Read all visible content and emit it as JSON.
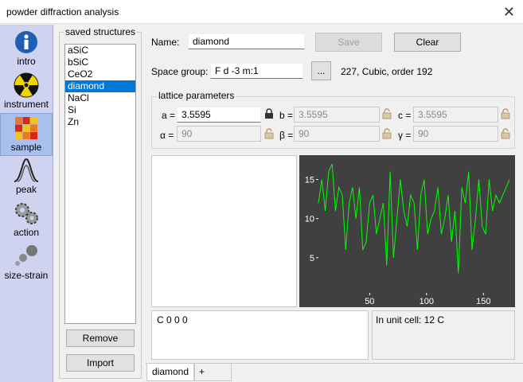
{
  "window": {
    "title": "powder diffraction analysis"
  },
  "sidebar": {
    "items": [
      {
        "label": "intro",
        "icon": "info-icon"
      },
      {
        "label": "instrument",
        "icon": "radiation-icon"
      },
      {
        "label": "sample",
        "icon": "sample-grid-icon"
      },
      {
        "label": "peak",
        "icon": "peak-icon"
      },
      {
        "label": "action",
        "icon": "gears-icon"
      },
      {
        "label": "size-strain",
        "icon": "spheres-icon"
      }
    ]
  },
  "saved": {
    "title": "saved structures",
    "items": [
      "aSiC",
      "bSiC",
      "CeO2",
      "diamond",
      "NaCl",
      "Si",
      "Zn"
    ],
    "selected": "diamond",
    "remove_label": "Remove",
    "import_label": "Import"
  },
  "form": {
    "name_label": "Name:",
    "name_value": "diamond",
    "save_label": "Save",
    "clear_label": "Clear",
    "space_group_label": "Space group:",
    "space_group_value": "F d -3 m:1",
    "browse_label": "...",
    "space_group_info": "227, Cubic, order 192"
  },
  "lattice": {
    "title": "lattice parameters",
    "a_label": "a =",
    "a_value": "3.5595",
    "b_label": "b =",
    "b_value": "3.5595",
    "c_label": "c =",
    "c_value": "3.5595",
    "alpha_label": "α =",
    "alpha_value": "90",
    "beta_label": "β =",
    "beta_value": "90",
    "gamma_label": "γ =",
    "gamma_value": "90"
  },
  "atoms": {
    "text": "C 0 0 0"
  },
  "unit_cell": {
    "text": "In unit cell: 12 C"
  },
  "tabs": {
    "active": "diamond",
    "add": "+"
  },
  "colors": {
    "plot_bg": "#404040",
    "plot_line": "#00ff00",
    "selection": "#0078d7",
    "sidebar": "#cfd3f0"
  },
  "chart_data": {
    "type": "line",
    "title": "",
    "xlabel": "",
    "ylabel": "",
    "xlim": [
      5,
      175
    ],
    "ylim": [
      0.5,
      17.5
    ],
    "xticks": [
      50,
      100,
      150
    ],
    "yticks": [
      5,
      10,
      15
    ],
    "series": [
      {
        "x": [
          5,
          8,
          11,
          14,
          17,
          20,
          23,
          26,
          29,
          32,
          35,
          38,
          41,
          44,
          47,
          50,
          53,
          56,
          59,
          62,
          65,
          68,
          71,
          74,
          77,
          80,
          83,
          86,
          89,
          92,
          95,
          98,
          101,
          104,
          107,
          110,
          113,
          116,
          119,
          122,
          125,
          128,
          131,
          134,
          137,
          140,
          143,
          146,
          149,
          152,
          155,
          158,
          161,
          164,
          167,
          170,
          173
        ],
        "values": [
          12,
          15,
          11,
          16,
          17,
          11,
          14,
          13,
          6,
          12,
          14,
          10,
          14,
          6,
          7,
          12,
          13,
          8,
          10,
          12,
          4,
          16,
          5,
          10,
          15,
          11,
          9,
          13,
          12,
          6,
          13,
          15,
          8,
          10,
          11,
          14,
          8,
          10,
          13,
          7,
          11,
          3,
          14,
          12,
          16,
          6,
          10,
          15,
          9,
          8,
          15,
          11,
          13,
          12,
          13,
          14,
          15
        ]
      }
    ]
  }
}
